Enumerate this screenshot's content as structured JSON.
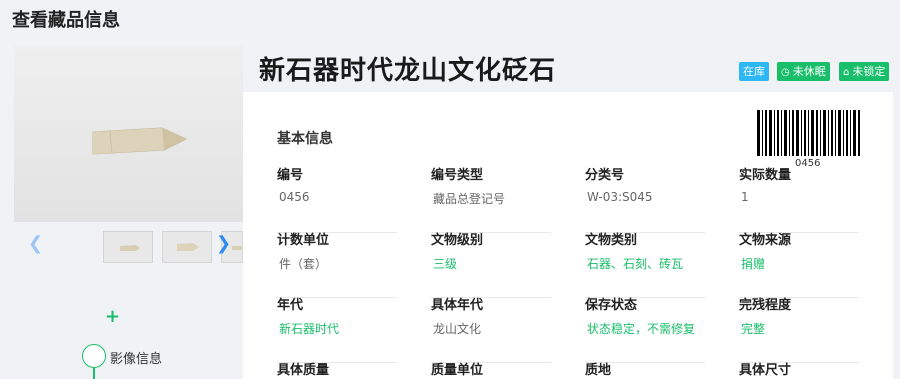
{
  "page": {
    "title": "查看藏品信息"
  },
  "object": {
    "name": "新石器时代龙山文化砭石",
    "barcode_number": "0456"
  },
  "badges": {
    "status": "在库",
    "sleep": "未休眠",
    "lock": "未锁定"
  },
  "gallery": {
    "prev_icon": "chevron-left-icon",
    "next_icon": "chevron-right-icon"
  },
  "timeline": {
    "label": "影像信息"
  },
  "section": {
    "title": "基本信息"
  },
  "fields": {
    "number": {
      "label": "编号",
      "value": "0456"
    },
    "number_type": {
      "label": "编号类型",
      "value": "藏品总登记号"
    },
    "category_no": {
      "label": "分类号",
      "value": "W-03:S045"
    },
    "actual_qty": {
      "label": "实际数量",
      "value": "1"
    },
    "count_unit": {
      "label": "计数单位",
      "value": "件（套）"
    },
    "relic_level": {
      "label": "文物级别",
      "value": "三级"
    },
    "relic_category": {
      "label": "文物类别",
      "value": "石器、石刻、砖瓦"
    },
    "relic_source": {
      "label": "文物来源",
      "value": "捐赠"
    },
    "era": {
      "label": "年代",
      "value": "新石器时代"
    },
    "specific_era": {
      "label": "具体年代",
      "value": "龙山文化"
    },
    "preservation": {
      "label": "保存状态",
      "value": "状态稳定，不需修复"
    },
    "integrity": {
      "label": "完残程度",
      "value": "完整"
    },
    "specific_mass": {
      "label": "具体质量",
      "value": ""
    },
    "mass_unit": {
      "label": "质量单位",
      "value": ""
    },
    "material": {
      "label": "质地",
      "value": ""
    },
    "specific_size": {
      "label": "具体尺寸",
      "value": ""
    }
  },
  "colors": {
    "accent_green": "#19be6b",
    "accent_blue": "#2db7f5",
    "link_blue": "#2d8cf0"
  }
}
